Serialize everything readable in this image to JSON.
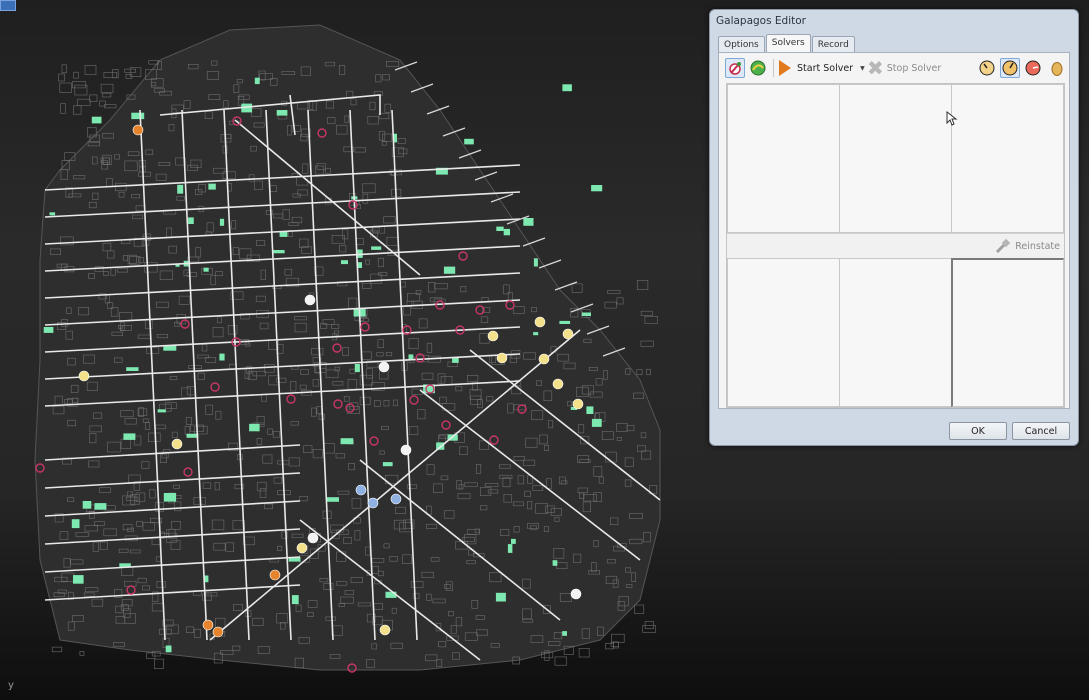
{
  "viewport": {
    "axis_label": "y",
    "background": "#232323",
    "street_color": "#e9e9e9",
    "block_color": "#6d6d6d",
    "park_color": "#7de8b0",
    "marker_colors": {
      "yellow": "#f3e08a",
      "orange": "#e5842c",
      "blue": "#8fb2e3",
      "white": "#f2f2f2",
      "magenta": "#c8356a"
    }
  },
  "dialog": {
    "title": "Galapagos Editor",
    "tabs": [
      {
        "label": "Options",
        "active": false
      },
      {
        "label": "Solvers",
        "active": true
      },
      {
        "label": "Record",
        "active": false
      }
    ],
    "toolbar": {
      "evolutionary_solver_icon": "evolution-icon",
      "annealing_solver_icon": "annealing-icon",
      "start_label": "Start Solver",
      "stop_label": "Stop Solver",
      "dropdown_icon": "dropdown-arrow-icon",
      "view_icons": [
        "clock-icon",
        "dial-icon",
        "gauge-icon",
        "egg-icon"
      ]
    },
    "reinstate_label": "Reinstate",
    "ok_label": "OK",
    "cancel_label": "Cancel"
  }
}
